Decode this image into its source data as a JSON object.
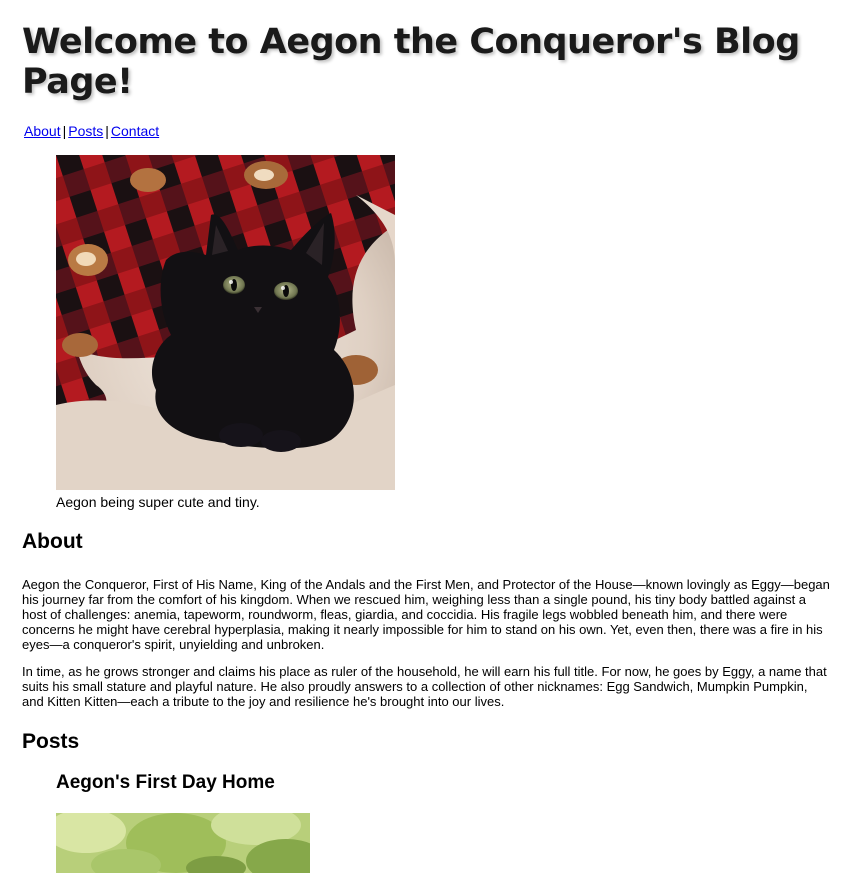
{
  "header": {
    "title": "Welcome to Aegon the Conqueror's Blog Page!"
  },
  "nav": {
    "links": [
      {
        "label": "About"
      },
      {
        "label": "Posts"
      },
      {
        "label": "Contact"
      }
    ],
    "separator": "|"
  },
  "hero": {
    "image_subject": "black kitten on red plaid blanket and fluffy cream rug",
    "caption": "Aegon being super cute and tiny."
  },
  "about": {
    "heading": "About",
    "paragraphs": [
      "Aegon the Conqueror, First of His Name, King of the Andals and the First Men, and Protector of the House—known lovingly as Eggy—began his journey far from the comfort of his kingdom. When we rescued him, weighing less than a single pound, his tiny body battled against a host of challenges: anemia, tapeworm, roundworm, fleas, giardia, and coccidia. His fragile legs wobbled beneath him, and there were concerns he might have cerebral hyperplasia, making it nearly impossible for him to stand on his own. Yet, even then, there was a fire in his eyes—a conqueror's spirit, unyielding and unbroken.",
      "In time, as he grows stronger and claims his place as ruler of the household, he will earn his full title. For now, he goes by Eggy, a name that suits his small stature and playful nature. He also proudly answers to a collection of other nicknames: Egg Sandwich, Mumpkin Pumpkin, and Kitten Kitten—each a tribute to the joy and resilience he's brought into our lives."
    ]
  },
  "posts": {
    "heading": "Posts",
    "items": [
      {
        "title": "Aegon's First Day Home",
        "image_subject": "green leafy outdoor photo"
      }
    ]
  }
}
